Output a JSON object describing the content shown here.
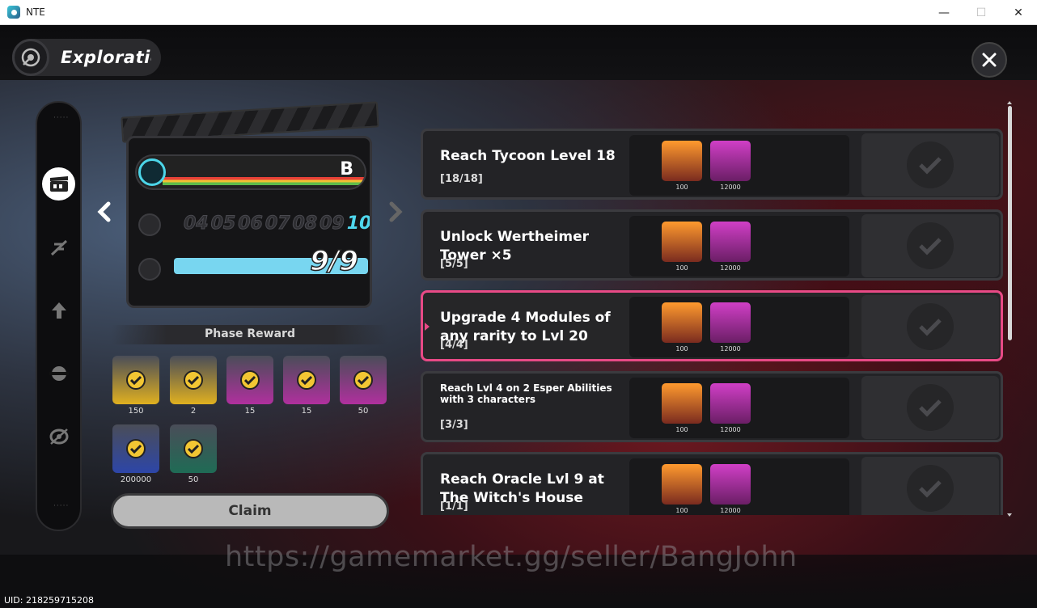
{
  "window": {
    "title": "NTE",
    "minimize": "—",
    "maximize": "☐",
    "close": "✕"
  },
  "header": {
    "title": "Exploration"
  },
  "clapper": {
    "grade": "B",
    "frames": [
      "04",
      "05",
      "06",
      "07",
      "08",
      "09",
      "10"
    ],
    "current_frame": "10",
    "progress_text": "9/9",
    "progress_fraction": 1.0
  },
  "phase_reward": {
    "title": "Phase Reward",
    "items": [
      {
        "amount": "150",
        "color": "#e0b020"
      },
      {
        "amount": "2",
        "color": "#e0b020"
      },
      {
        "amount": "15",
        "color": "#b0309e"
      },
      {
        "amount": "15",
        "color": "#b0309e"
      },
      {
        "amount": "50",
        "color": "#b0309e"
      },
      {
        "amount": "200000",
        "color": "#2d46a8"
      },
      {
        "amount": "50",
        "color": "#1f6b55"
      }
    ],
    "claim_label": "Claim"
  },
  "tasks": [
    {
      "title": "Reach Tycoon Level 18",
      "progress": "[18/18]",
      "reward_1": "100",
      "reward_2": "12000"
    },
    {
      "title": "Unlock Wertheimer Tower ×5",
      "progress": "[5/5]",
      "reward_1": "100",
      "reward_2": "12000"
    },
    {
      "title": "Upgrade 4 Modules of any rarity to Lvl 20",
      "progress": "[4/4]",
      "reward_1": "100",
      "reward_2": "12000"
    },
    {
      "title": "Reach Lvl 4 on 2 Esper Abilities with 3 characters",
      "progress": "[3/3]",
      "reward_1": "100",
      "reward_2": "12000"
    },
    {
      "title": "Reach Oracle Lvl 9 at The Witch's House",
      "progress": "[1/1]",
      "reward_1": "100",
      "reward_2": "12000"
    }
  ],
  "watermark": "https://gamemarket.gg/seller/BangJohn",
  "uid": "UID: 218259715208",
  "colors": {
    "accent": "#e84a86",
    "progress": "#78d6f0",
    "frame_current": "#4fd7ee"
  }
}
